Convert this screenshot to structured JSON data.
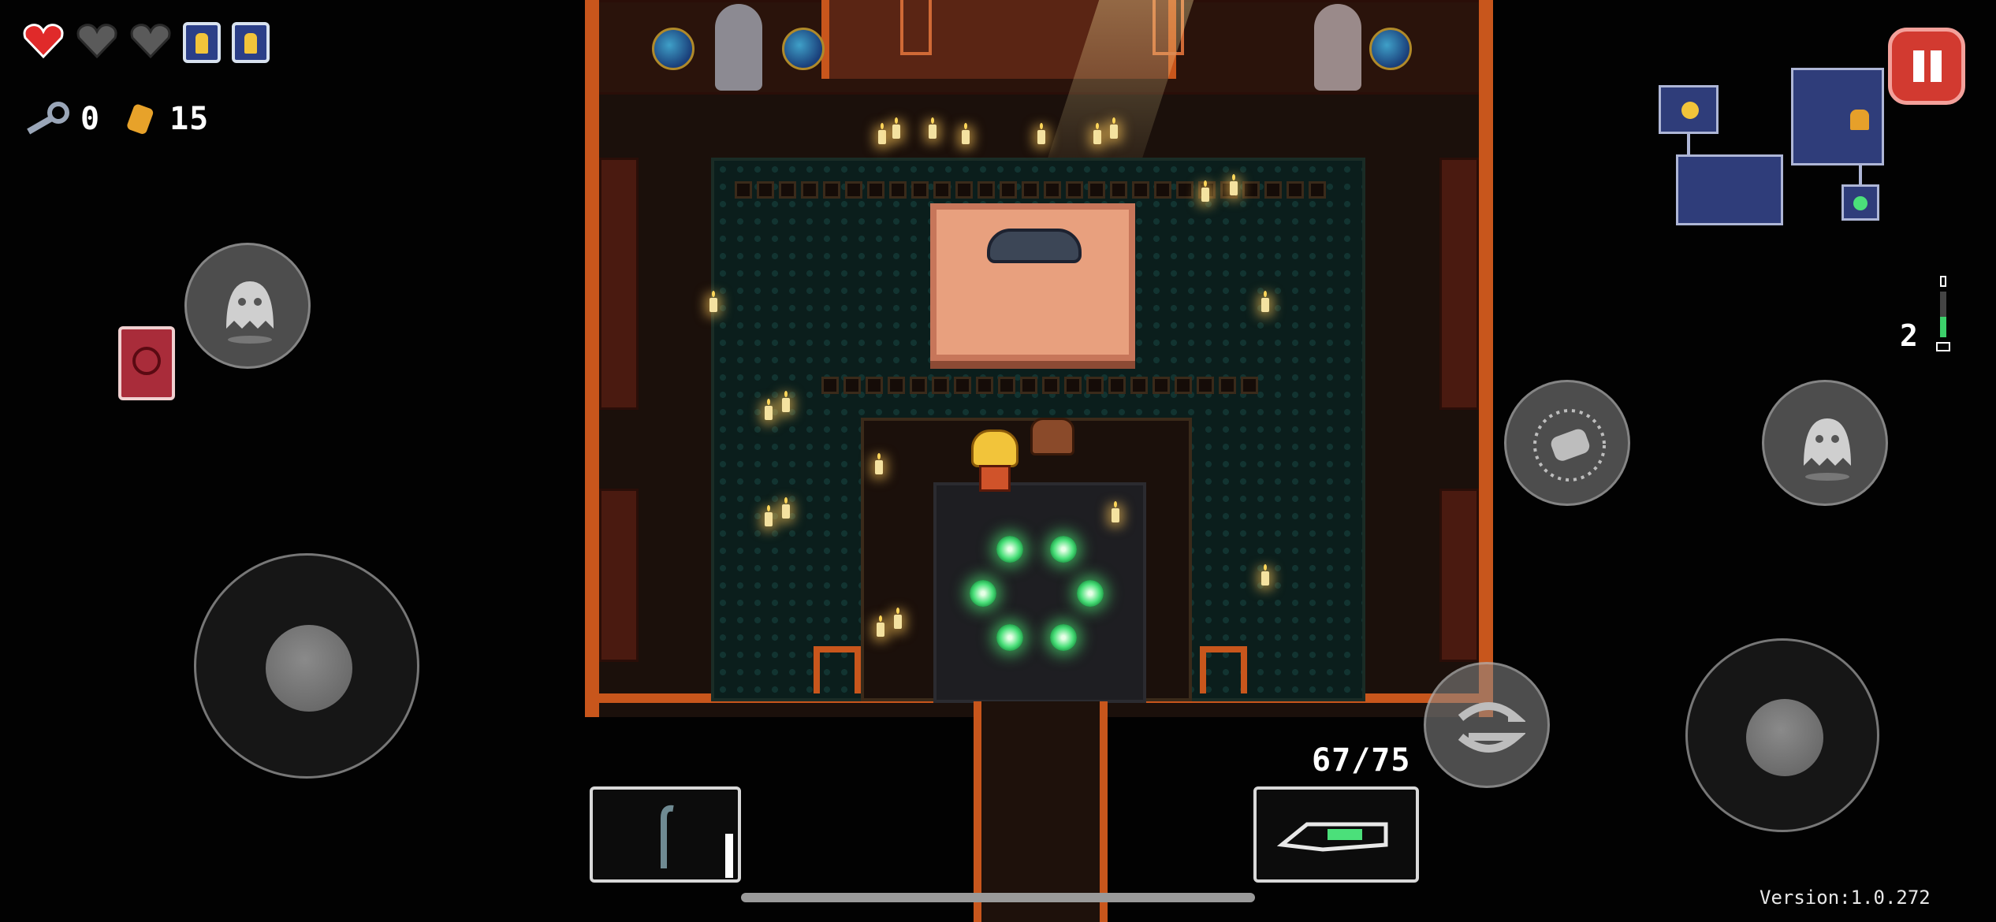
{
  "hud": {
    "hearts": [
      {
        "state": "full",
        "icon": "red-heart-icon",
        "color": "#e02a2a"
      },
      {
        "state": "empty",
        "icon": "empty-heart-icon",
        "color": "#5a5a5a"
      },
      {
        "state": "empty",
        "icon": "empty-heart-icon",
        "color": "#5a5a5a"
      }
    ],
    "blanks_count_icons": 2,
    "keys": "0",
    "shells": "15",
    "floor_indicator": "2",
    "ammo": "67/75",
    "version": "Version:1.0.272"
  },
  "controls": {
    "pause_icon": "pause-icon",
    "active_item_icon": "red-book-icon",
    "blank_button_icon": "ghost-icon",
    "dodge_button_icon": "ghost-icon",
    "reload_button_icon": "cylinder-reload-icon",
    "swap_button_icon": "swap-arrows-icon",
    "passive_item_icon": "crowbar-icon",
    "gun_icon": "green-rifle-icon"
  },
  "colors": {
    "accent_orange": "#c8561c",
    "pause_red": "#d23a30",
    "teleporter_green": "#4be07a",
    "map_blue": "#2f3d7a"
  }
}
